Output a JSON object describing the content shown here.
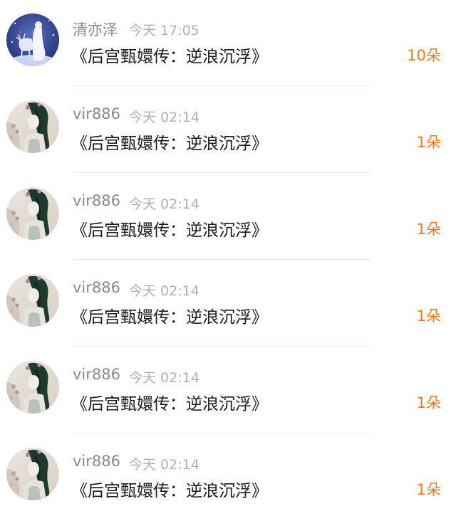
{
  "gifts": [
    {
      "name": "清亦泽",
      "time": "今天 17:05",
      "title": "《后宫甄嬛传：逆浪沉浮》",
      "count": "10朵",
      "avatar": "snow-deer-avatar"
    },
    {
      "name": "vir886",
      "time": "今天 02:14",
      "title": "《后宫甄嬛传：逆浪沉浮》",
      "count": "1朵",
      "avatar": "painted-lady-avatar"
    },
    {
      "name": "vir886",
      "time": "今天 02:14",
      "title": "《后宫甄嬛传：逆浪沉浮》",
      "count": "1朵",
      "avatar": "painted-lady-avatar"
    },
    {
      "name": "vir886",
      "time": "今天 02:14",
      "title": "《后宫甄嬛传：逆浪沉浮》",
      "count": "1朵",
      "avatar": "painted-lady-avatar"
    },
    {
      "name": "vir886",
      "time": "今天 02:14",
      "title": "《后宫甄嬛传：逆浪沉浮》",
      "count": "1朵",
      "avatar": "painted-lady-avatar"
    },
    {
      "name": "vir886",
      "time": "今天 02:14",
      "title": "《后宫甄嬛传：逆浪沉浮》",
      "count": "1朵",
      "avatar": "painted-lady-avatar"
    }
  ],
  "colors": {
    "count": "#f07a1f",
    "name": "#8a8a8a",
    "time": "#b0b0b0",
    "title": "#1a1a1a"
  }
}
